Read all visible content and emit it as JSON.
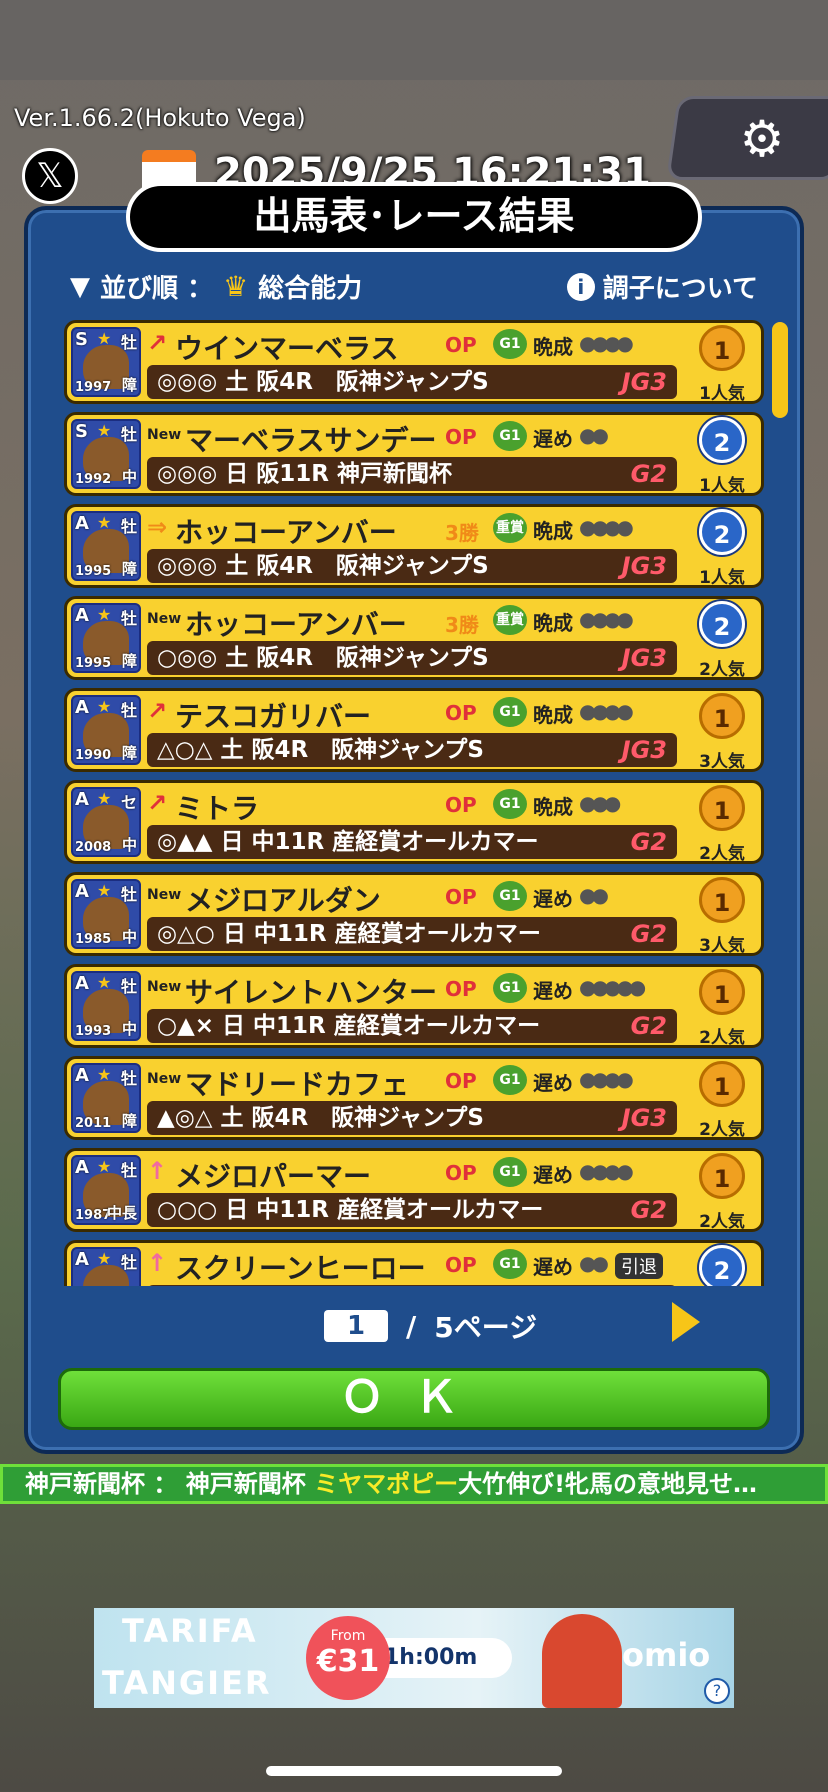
{
  "header": {
    "version": "Ver.1.66.2(Hokuto Vega)",
    "clock": "2025/9/25 16:21:31"
  },
  "panel": {
    "title": "出馬表･レース結果",
    "sort_label": "並び順 ： ",
    "sort_value": "総合能力",
    "info_label": "調子について"
  },
  "rows": [
    {
      "grade": "S",
      "sex": "牡",
      "year": "1997",
      "dist": "障",
      "trend": "↗",
      "trend_color": "#e0303a",
      "name": "ウインマーベラス",
      "klass": "OP",
      "klass_color": "#e0303a",
      "gtag": "G1",
      "growth": "晩成",
      "dots": "●●●●",
      "race": "◎◎◎ 土 阪4R　阪神ジャンプS",
      "rgrade": "JG3",
      "medal": "1",
      "medal_type": "gold",
      "pop": "1人気"
    },
    {
      "grade": "S",
      "sex": "牡",
      "year": "1992",
      "dist": "中",
      "trend": "New",
      "trend_color": "#222",
      "name": "マーベラスサンデー",
      "klass": "OP",
      "klass_color": "#e0303a",
      "gtag": "G1",
      "growth": "遅め",
      "dots": "●●",
      "race": "◎◎◎ 日 阪11R 神戸新聞杯",
      "rgrade": "G2",
      "medal": "2",
      "medal_type": "blue",
      "pop": "1人気"
    },
    {
      "grade": "A",
      "sex": "牡",
      "year": "1995",
      "dist": "障",
      "trend": "⇒",
      "trend_color": "#f08a18",
      "name": "ホッコーアンバー",
      "klass": "3勝",
      "klass_color": "#f08a18",
      "gtag": "重賞",
      "growth": "晩成",
      "dots": "●●●●",
      "race": "◎◎◎ 土 阪4R　阪神ジャンプS",
      "rgrade": "JG3",
      "medal": "2",
      "medal_type": "blue",
      "pop": "1人気"
    },
    {
      "grade": "A",
      "sex": "牡",
      "year": "1995",
      "dist": "障",
      "trend": "New",
      "trend_color": "#222",
      "name": "ホッコーアンバー",
      "klass": "3勝",
      "klass_color": "#f08a18",
      "gtag": "重賞",
      "growth": "晩成",
      "dots": "●●●●",
      "race": "○◎◎ 土 阪4R　阪神ジャンプS",
      "rgrade": "JG3",
      "medal": "2",
      "medal_type": "blue",
      "pop": "2人気"
    },
    {
      "grade": "A",
      "sex": "牡",
      "year": "1990",
      "dist": "障",
      "trend": "↗",
      "trend_color": "#e0303a",
      "name": "テスコガリバー",
      "klass": "OP",
      "klass_color": "#e0303a",
      "gtag": "G1",
      "growth": "晩成",
      "dots": "●●●●",
      "race": "△○△ 土 阪4R　阪神ジャンプS",
      "rgrade": "JG3",
      "medal": "1",
      "medal_type": "gold",
      "pop": "3人気"
    },
    {
      "grade": "A",
      "sex": "セ",
      "year": "2008",
      "dist": "中",
      "trend": "↗",
      "trend_color": "#e0303a",
      "name": "ミトラ",
      "klass": "OP",
      "klass_color": "#e0303a",
      "gtag": "G1",
      "growth": "晩成",
      "dots": "●●●",
      "race": "◎▲▲ 日 中11R 産経賞オールカマー",
      "rgrade": "G2",
      "medal": "1",
      "medal_type": "gold",
      "pop": "2人気"
    },
    {
      "grade": "A",
      "sex": "牡",
      "year": "1985",
      "dist": "中",
      "trend": "New",
      "trend_color": "#222",
      "name": "メジロアルダン",
      "klass": "OP",
      "klass_color": "#e0303a",
      "gtag": "G1",
      "growth": "遅め",
      "dots": "●●",
      "race": "◎△○ 日 中11R 産経賞オールカマー",
      "rgrade": "G2",
      "medal": "1",
      "medal_type": "gold",
      "pop": "3人気"
    },
    {
      "grade": "A",
      "sex": "牡",
      "year": "1993",
      "dist": "中",
      "trend": "New",
      "trend_color": "#222",
      "name": "サイレントハンター",
      "klass": "OP",
      "klass_color": "#e0303a",
      "gtag": "G1",
      "growth": "遅め",
      "dots": "●●●●●",
      "race": "○▲× 日 中11R 産経賞オールカマー",
      "rgrade": "G2",
      "medal": "1",
      "medal_type": "gold",
      "pop": "2人気"
    },
    {
      "grade": "A",
      "sex": "牡",
      "year": "2011",
      "dist": "障",
      "trend": "New",
      "trend_color": "#222",
      "name": "マドリードカフェ",
      "klass": "OP",
      "klass_color": "#e0303a",
      "gtag": "G1",
      "growth": "遅め",
      "dots": "●●●●",
      "race": "▲◎△ 土 阪4R　阪神ジャンプS",
      "rgrade": "JG3",
      "medal": "1",
      "medal_type": "gold",
      "pop": "2人気"
    },
    {
      "grade": "A",
      "sex": "牡",
      "year": "1987",
      "dist": "中長",
      "trend": "↑",
      "trend_color": "#f06aa0",
      "name": "メジロパーマー",
      "klass": "OP",
      "klass_color": "#e0303a",
      "gtag": "G1",
      "growth": "遅め",
      "dots": "●●●●",
      "race": "○○○ 日 中11R 産経賞オールカマー",
      "rgrade": "G2",
      "medal": "1",
      "medal_type": "gold",
      "pop": "2人気"
    },
    {
      "grade": "A",
      "sex": "牡",
      "year": "",
      "dist": "",
      "trend": "↑",
      "trend_color": "#f06aa0",
      "name": "スクリーンヒーロー",
      "klass": "OP",
      "klass_color": "#e0303a",
      "gtag": "G1",
      "growth": "遅め",
      "dots": "●●",
      "retire": "引退",
      "race": "",
      "rgrade": "",
      "medal": "2",
      "medal_type": "blue",
      "pop": ""
    }
  ],
  "pager": {
    "current": "1",
    "slash": "/",
    "total": "5ページ"
  },
  "ok_label": "ＯＫ",
  "ticker": {
    "prefix": "神戸新聞杯 ： 神戸新聞杯 ",
    "highlight": "ミヤマポピー",
    "suffix": "大竹伸び!牝馬の意地見せ…"
  },
  "ad": {
    "line1": "TARIFA",
    "line2": "TANGIER",
    "from": "From",
    "price": "€31",
    "duration": "1h:00m",
    "brand": "omio",
    "help": "?"
  }
}
